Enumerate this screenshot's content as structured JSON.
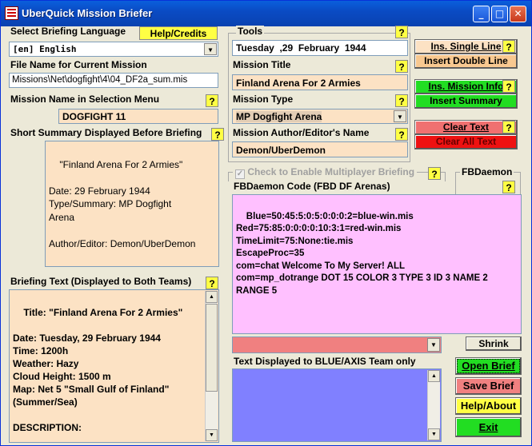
{
  "window": {
    "title": "UberQuick Mission Briefer",
    "minimize": "_",
    "maximize": "□",
    "close": "✕"
  },
  "left": {
    "language_label": "Select Briefing Language",
    "help_credits": "Help/Credits",
    "language_value": "[en] English",
    "filename_label": "File Name for Current Mission",
    "filename_value": "Missions\\Net\\dogfight\\4\\04_DF2a_sum.mis",
    "menu_name_label": "Mission Name in Selection Menu",
    "menu_name_value": "DOGFIGHT 11",
    "summary_label": "Short Summary Displayed Before Briefing",
    "summary_text": "\"Finland Arena For 2 Armies\"\n\nDate: 29 February 1944\nType/Summary: MP Dogfight\nArena\n\nAuthor/Editor: Demon/UberDemon",
    "briefing_label": "Briefing Text (Displayed to Both Teams)",
    "briefing_text": "Title: \"Finland Arena For 2 Armies\"\n\nDate: Tuesday, 29 February 1944\nTime: 1200h\nWeather: Hazy\nCloud Height: 1500 m\nMap: Net 5 \"Small Gulf of Finland\"\n(Summer/Sea)\n\nDESCRIPTION:",
    "q": "?"
  },
  "tools": {
    "label": "Tools",
    "date_value": "Tuesday  ,29  February  1944",
    "mission_title_label": "Mission Title",
    "mission_title_value": "Finland Arena For 2 Armies",
    "mission_type_label": "Mission Type",
    "mission_type_value": "MP Dogfight Arena",
    "author_label": "Mission Author/Editor's Name",
    "author_value": "Demon/UberDemon",
    "ins_single_line": "Ins. Single Line",
    "insert_double_line": "Insert Double Line",
    "ins_mission_info": "Ins. Mission Info",
    "insert_summary": "Insert Summary",
    "clear_text": "Clear Text",
    "clear_all_text": "Clear All Text"
  },
  "fbd": {
    "multiplayer_check_label": "Check to Enable Multiplayer Briefing",
    "code_label": "FBDaemon Code (FBD DF Arenas)",
    "fbdaemon_label": "FBDaemon",
    "code_text": "Blue=50:45:5:0:5:0:0:0:2=blue-win.mis\nRed=75:85:0:0:0:0:10:3:1=red-win.mis\nTimeLimit=75:None:tie.mis\nEscapeProc=35\ncom=chat Welcome To My Server! ALL\ncom=mp_dotrange DOT 15 COLOR 3 TYPE 3 ID 3 NAME 2\nRANGE 5",
    "shrink": "Shrink",
    "blue_label": "Text Displayed to BLUE/AXIS Team only"
  },
  "actions": {
    "open_brief": "Open Brief",
    "save_brief": "Save Brief",
    "help_about": "Help/About",
    "exit": "Exit"
  },
  "colors": {
    "peach": "#fce2c4",
    "yellow": "#ffff44",
    "green": "#22dd22",
    "red": "#ee1111",
    "pink": "#ffc0ff",
    "blue_field": "#8080ff",
    "salmon": "#f08080"
  }
}
